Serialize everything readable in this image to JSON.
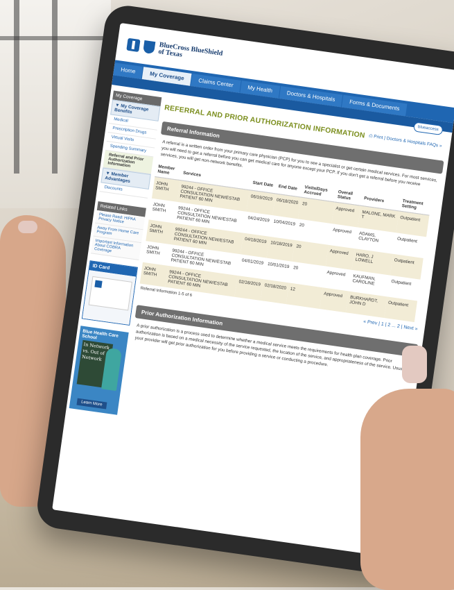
{
  "brand": {
    "name_line1": "BlueCross BlueShield",
    "name_line2": "of Texas"
  },
  "nav": {
    "tabs": [
      "Home",
      "My Coverage",
      "Claims Center",
      "My Health",
      "Doctors & Hospitals",
      "Forms & Documents"
    ],
    "active": "My Coverage"
  },
  "blueaccess": "blueaccess",
  "sidebar": {
    "header": "My Coverage",
    "group1": "▼ My Coverage Benefits",
    "items": [
      "Medical",
      "Prescription Drugs",
      "Virtual Visits",
      "Spending Summary",
      "Referral and Prior Authorization Information"
    ],
    "group2": "▼ Member Advantages",
    "items2": [
      "Discounts"
    ],
    "links_header": "Related Links",
    "links": [
      "Please Read: HIPAA Privacy Notice",
      "Away From Home Care Program",
      "Important Information About COBRA Coverage"
    ],
    "idcard_header": "ID Card",
    "promo_title": "Blue Health Care School",
    "promo_board": "In Network vs. Out of Network",
    "promo_button": "Learn More"
  },
  "main": {
    "title": "REFERRAL AND PRIOR AUTHORIZATION INFORMATION",
    "print": "Print",
    "faqs": "Doctors & Hospitals FAQs »",
    "referral_header": "Referral Information",
    "referral_intro": "A referral is a written order from your primary care physician (PCP) for you to see a specialist or get certain medical services. For most services, you will need to get a referral before you can get medical care for anyone except your PCP. If you don't get a referral before you receive services, you will get non-network benefits.",
    "columns": [
      "Member Name",
      "Services",
      "Start Date",
      "End Date",
      "Visits/Days Accrued",
      "Overall Status",
      "Providers",
      "Treatment Setting"
    ],
    "rows": [
      [
        "JOHN SMITH",
        "99244 - OFFICE CONSULTATION NEW/ESTAB PATIENT 60 MIN",
        "06/19/2019",
        "06/18/2020",
        "20",
        "Approved",
        "MALONE, MARK T",
        "Outpatient"
      ],
      [
        "JOHN SMITH",
        "99244 - OFFICE CONSULTATION NEW/ESTAB PATIENT 60 MIN",
        "04/24/2019",
        "10/04/2019",
        "20",
        "Approved",
        "ADAMS, CLAYTON",
        "Outpatient"
      ],
      [
        "JOHN SMITH",
        "99244 - OFFICE CONSULTATION NEW/ESTAB PATIENT 60 MIN",
        "04/18/2019",
        "10/18/2019",
        "20",
        "Approved",
        "HARO, J LOWELL",
        "Outpatient"
      ],
      [
        "JOHN SMITH",
        "99244 - OFFICE CONSULTATION NEW/ESTAB PATIENT 60 MIN",
        "04/01/2019",
        "10/01/2019",
        "20",
        "Approved",
        "KAUFMAN, CAROLINE",
        "Outpatient"
      ],
      [
        "JOHN SMITH",
        "99244 - OFFICE CONSULTATION NEW/ESTAB PATIENT 60 MIN",
        "02/18/2019",
        "02/18/2020",
        "12",
        "Approved",
        "BURKHARDT, JOHN D",
        "Outpatient"
      ]
    ],
    "range_text": "Referral Information 1-5 of 6",
    "pager": "« Prev | 1 | 2 ... 2 | Next »",
    "prior_header": "Prior Authorization Information",
    "prior_text": "A prior authorization is a process used to determine whether a medical service meets the requirements for health plan coverage. Prior authorization is based on a medical necessity of the service requested, the location of the service, and appropriateness of the service. Usually, your provider will get prior authorization for you before providing a service or conducting a procedure."
  }
}
